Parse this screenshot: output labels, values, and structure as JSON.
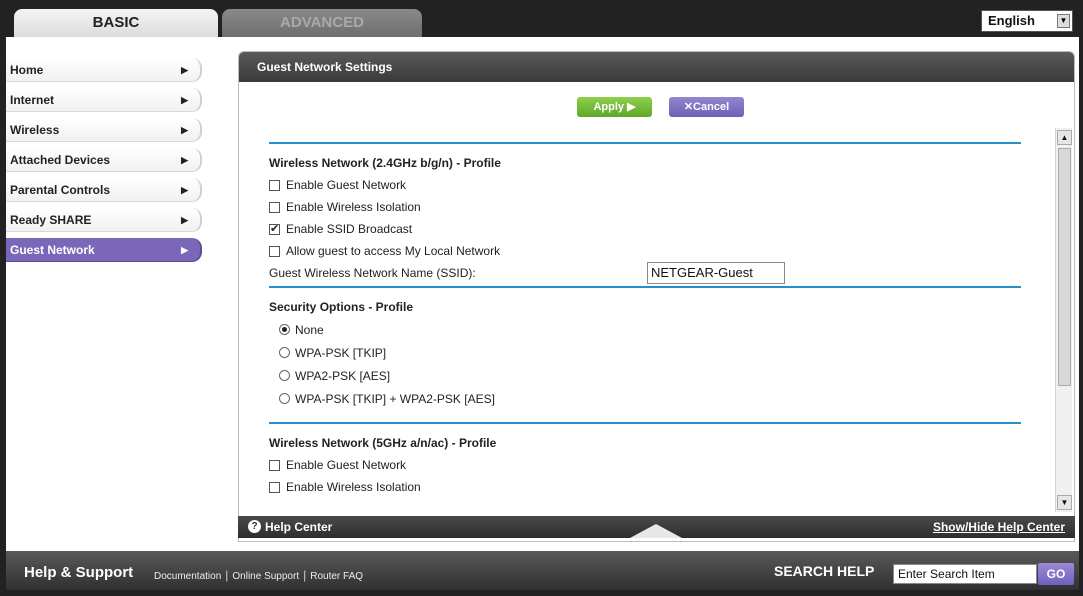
{
  "tabs": {
    "basic": "BASIC",
    "advanced": "ADVANCED"
  },
  "language": {
    "selected": "English"
  },
  "sidebar": {
    "items": [
      {
        "label": "Home"
      },
      {
        "label": "Internet"
      },
      {
        "label": "Wireless"
      },
      {
        "label": "Attached Devices"
      },
      {
        "label": "Parental Controls"
      },
      {
        "label": "Ready SHARE"
      },
      {
        "label": "Guest Network",
        "active": true
      }
    ]
  },
  "panel": {
    "title": "Guest Network Settings",
    "apply_label": "Apply ▶",
    "cancel_label": "✕Cancel"
  },
  "section_24": {
    "title": "Wireless Network (2.4GHz b/g/n) - Profile",
    "enable_guest": {
      "label": "Enable Guest Network",
      "checked": false
    },
    "wireless_isolation": {
      "label": "Enable Wireless Isolation",
      "checked": false
    },
    "ssid_broadcast": {
      "label": "Enable SSID Broadcast",
      "checked": true
    },
    "local_access": {
      "label": "Allow guest to access My Local Network",
      "checked": false
    },
    "ssid_label": "Guest Wireless Network Name (SSID):",
    "ssid_value": "NETGEAR-Guest"
  },
  "security": {
    "title": "Security Options - Profile",
    "options": [
      {
        "label": "None",
        "selected": true
      },
      {
        "label": "WPA-PSK [TKIP]",
        "selected": false
      },
      {
        "label": "WPA2-PSK [AES]",
        "selected": false
      },
      {
        "label": "WPA-PSK [TKIP] + WPA2-PSK [AES]",
        "selected": false
      }
    ]
  },
  "section_5": {
    "title": "Wireless Network (5GHz a/n/ac) - Profile",
    "enable_guest": {
      "label": "Enable Guest Network",
      "checked": false
    },
    "wireless_isolation": {
      "label": "Enable Wireless Isolation",
      "checked": false
    }
  },
  "help_center": {
    "title": "Help Center",
    "toggle": "Show/Hide Help Center"
  },
  "footer": {
    "title": "Help & Support",
    "links": [
      "Documentation",
      "Online Support",
      "Router FAQ"
    ],
    "search_label": "SEARCH HELP",
    "search_placeholder": "Enter Search Item",
    "go_label": "GO"
  },
  "colors": {
    "accent_purple": "#7a67b8",
    "apply_green": "#6fb732",
    "rule_blue": "#2a8dc6"
  },
  "icons": {
    "help": "question-circle-icon",
    "nav_arrow": "triangle-right-icon",
    "dropdown": "chevron-down-icon"
  }
}
